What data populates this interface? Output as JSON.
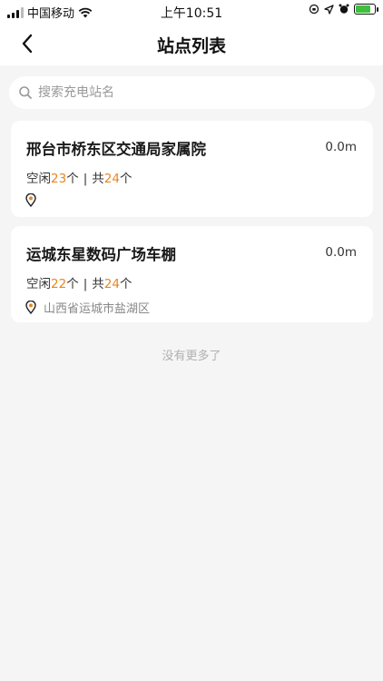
{
  "status_bar": {
    "carrier": "中国移动",
    "time": "上午10:51"
  },
  "nav": {
    "title": "站点列表"
  },
  "search": {
    "placeholder": "搜索充电站名"
  },
  "stations": [
    {
      "name": "邢台市桥东区交通局家属院",
      "distance": "0.0m",
      "free_label": "空闲",
      "free_count": "23",
      "unit": "个",
      "total_label": "共",
      "total_count": "24",
      "address": ""
    },
    {
      "name": "运城东星数码广场车棚",
      "distance": "0.0m",
      "free_label": "空闲",
      "free_count": "22",
      "unit": "个",
      "total_label": "共",
      "total_count": "24",
      "address": "山西省运城市盐湖区"
    }
  ],
  "footer": {
    "no_more": "没有更多了"
  },
  "colors": {
    "accent": "#e8851f",
    "background": "#f5f5f5",
    "card": "#ffffff"
  },
  "icons": [
    "back-arrow-icon",
    "search-icon",
    "location-pin-icon",
    "wifi-icon",
    "signal-icon",
    "battery-icon"
  ]
}
